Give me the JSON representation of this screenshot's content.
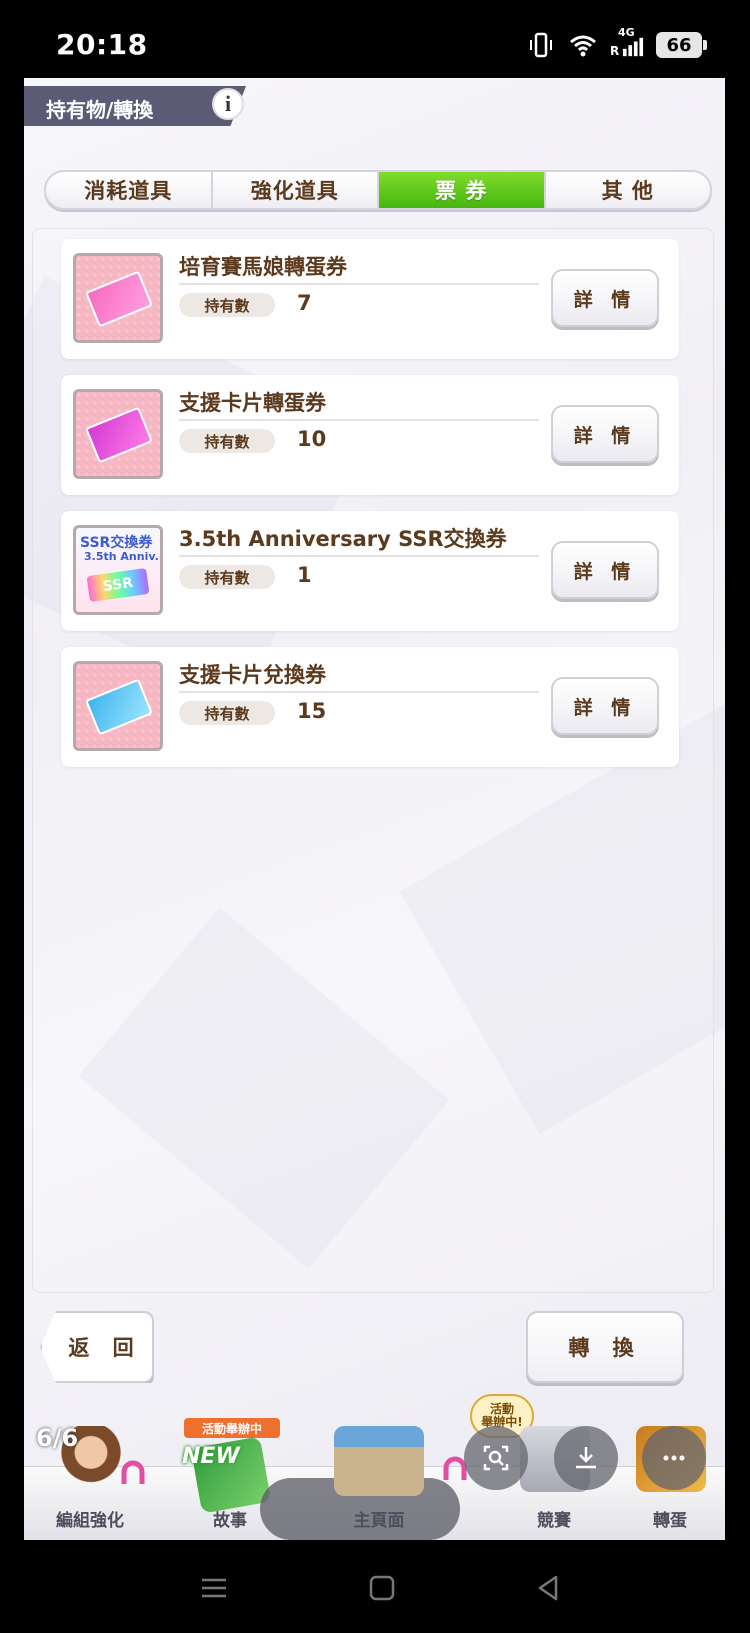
{
  "status_bar": {
    "time": "20:18",
    "network": "4G",
    "roaming": "R",
    "battery": "66"
  },
  "header": {
    "title": "持有物/轉換",
    "info_icon": "i"
  },
  "tabs": [
    {
      "label": "消耗道具",
      "active": false
    },
    {
      "label": "強化道具",
      "active": false
    },
    {
      "label": "票 券",
      "active": true
    },
    {
      "label": "其 他",
      "active": false
    }
  ],
  "items": [
    {
      "name": "培育賽馬娘轉蛋券",
      "qty_label": "持有數",
      "qty": "7",
      "detail": "詳 情",
      "icon": "pink-ticket-icon"
    },
    {
      "name": "支援卡片轉蛋券",
      "qty_label": "持有數",
      "qty": "10",
      "detail": "詳 情",
      "icon": "magenta-ticket-icon"
    },
    {
      "name": "3.5th Anniversary SSR交換券",
      "qty_label": "持有數",
      "qty": "1",
      "detail": "詳 情",
      "icon": "ssr-ticket-icon",
      "icon_text": [
        "SSR交換券",
        "3.5th Anniv.",
        "SSR"
      ]
    },
    {
      "name": "支援卡片兌換券",
      "qty_label": "持有數",
      "qty": "15",
      "detail": "詳 情",
      "icon": "blue-ticket-icon"
    }
  ],
  "actions": {
    "back": "返 回",
    "exchange": "轉 換"
  },
  "bottom_nav": {
    "page_count": "6/6",
    "items": [
      {
        "label": "編組強化"
      },
      {
        "label": "故事",
        "banner": "活動舉辦中",
        "badge": "NEW"
      },
      {
        "label": "主頁面"
      },
      {
        "label": "競賽",
        "badge": [
          "活動",
          "舉辦中!"
        ]
      },
      {
        "label": "轉蛋"
      }
    ]
  },
  "colors": {
    "active_tab": "#4cbb12",
    "text_brown": "#5b3a1e",
    "header_bg": "#5c5b76"
  }
}
